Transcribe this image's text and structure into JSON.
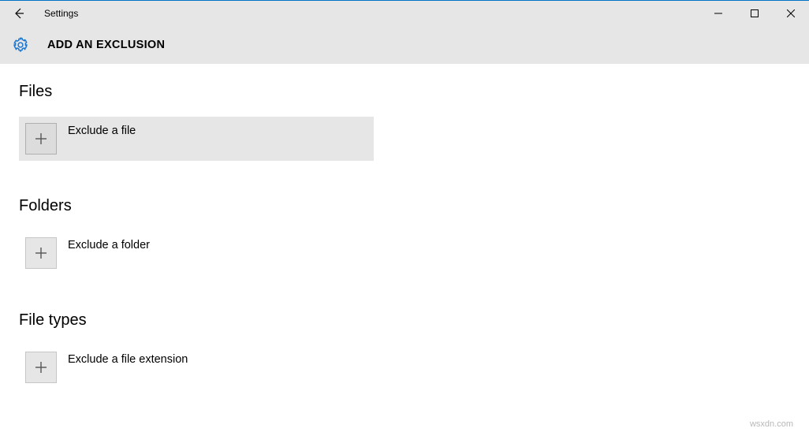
{
  "window": {
    "title": "Settings"
  },
  "page": {
    "heading": "ADD AN EXCLUSION"
  },
  "sections": {
    "files": {
      "title": "Files",
      "option": "Exclude a file"
    },
    "folders": {
      "title": "Folders",
      "option": "Exclude a folder"
    },
    "filetypes": {
      "title": "File types",
      "option": "Exclude a file extension"
    }
  },
  "watermark": "wsxdn.com"
}
